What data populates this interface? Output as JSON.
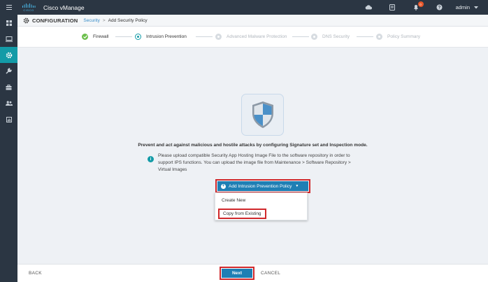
{
  "topbar": {
    "logo_text": "CISCO",
    "title": "Cisco vManage",
    "notification_count": "0",
    "user": "admin",
    "icons": [
      "menu-icon",
      "cloud-icon",
      "tasks-icon",
      "bell-icon",
      "help-icon"
    ]
  },
  "sidebar": {
    "items": [
      "dashboard-icon",
      "monitor-icon",
      "configuration-icon",
      "tools-icon",
      "maintenance-icon",
      "administration-icon",
      "analytics-icon"
    ],
    "active_index": 2
  },
  "header": {
    "title": "CONFIGURATION",
    "breadcrumb_link": "Security",
    "breadcrumb_sep": ">",
    "breadcrumb_current": "Add Security Policy"
  },
  "steps": [
    {
      "label": "Firewall",
      "state": "done"
    },
    {
      "label": "Intrusion Prevention",
      "state": "current"
    },
    {
      "label": "Advanced Malware Protection",
      "state": "pending"
    },
    {
      "label": "DNS Security",
      "state": "pending"
    },
    {
      "label": "Policy Summary",
      "state": "pending"
    }
  ],
  "main": {
    "headline": "Prevent and act against malicious and hostile attacks by configuring Signature set and Inspection mode.",
    "info_line1": "Please upload compatible Security App Hosting Image File to the software repository in order to",
    "info_line2": "support IPS functions. You can upload the image file from Maintenance > Software Repository >",
    "info_line3": "Virtual Images",
    "add_button": "Add Intrusion Prevention Policy",
    "menu_items": [
      "Create New",
      "Copy from Existing"
    ]
  },
  "footer": {
    "back": "BACK",
    "next": "Next",
    "cancel": "CANCEL"
  },
  "colors": {
    "topbar": "#2b3643",
    "accent_teal": "#139ba7",
    "primary_button": "#1f7fb4",
    "highlight_red": "#d0282b",
    "step_done": "#6cbf4c"
  }
}
